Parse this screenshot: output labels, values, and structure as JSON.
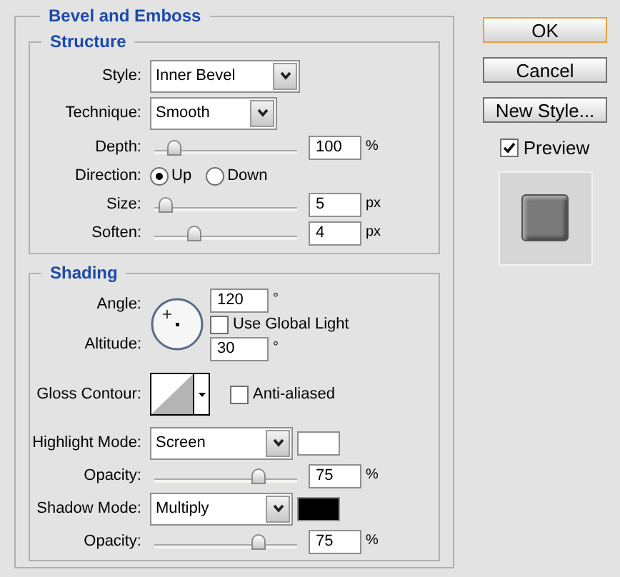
{
  "section_title": "Bevel and Emboss",
  "structure": {
    "title": "Structure",
    "rows": [
      {
        "kind": "select",
        "label": "Style:",
        "value": "Inner Bevel"
      },
      {
        "kind": "select",
        "label": "Technique:",
        "value": "Smooth"
      },
      {
        "kind": "slider",
        "label": "Depth:",
        "level": 0.1,
        "value": "100",
        "unit": "%"
      },
      {
        "kind": "radio",
        "label": "Direction:",
        "options": [
          {
            "label": "Up",
            "selected": true
          },
          {
            "label": "Down",
            "selected": false
          }
        ]
      },
      {
        "kind": "slider",
        "label": "Size:",
        "level": 0.03,
        "value": "5",
        "unit": "px"
      },
      {
        "kind": "slider",
        "label": "Soften:",
        "level": 0.25,
        "value": "4",
        "unit": "px"
      }
    ]
  },
  "shading": {
    "title": "Shading",
    "angle": {
      "label": "Angle:",
      "value": "120",
      "unit": "°"
    },
    "use_global_light": {
      "label": "Use Global Light",
      "checked": false
    },
    "altitude": {
      "label": "Altitude:",
      "value": "30",
      "unit": "°"
    },
    "gloss_contour": {
      "label": "Gloss Contour:"
    },
    "anti_aliased": {
      "label": "Anti-aliased",
      "checked": false
    },
    "rows": [
      {
        "kind": "mode",
        "label": "Highlight Mode:",
        "value": "Screen",
        "color": "#ffffff"
      },
      {
        "kind": "slider",
        "label": "Opacity:",
        "level": 0.75,
        "value": "75",
        "unit": "%"
      },
      {
        "kind": "mode",
        "label": "Shadow Mode:",
        "value": "Multiply",
        "color": "#000000"
      },
      {
        "kind": "slider",
        "label": "Opacity:",
        "level": 0.75,
        "value": "75",
        "unit": "%"
      }
    ]
  },
  "buttons": [
    {
      "label": "OK",
      "default": true
    },
    {
      "label": "Cancel",
      "default": false
    },
    {
      "label": "New Style...",
      "default": false
    }
  ],
  "preview": {
    "label": "Preview",
    "checked": true
  }
}
